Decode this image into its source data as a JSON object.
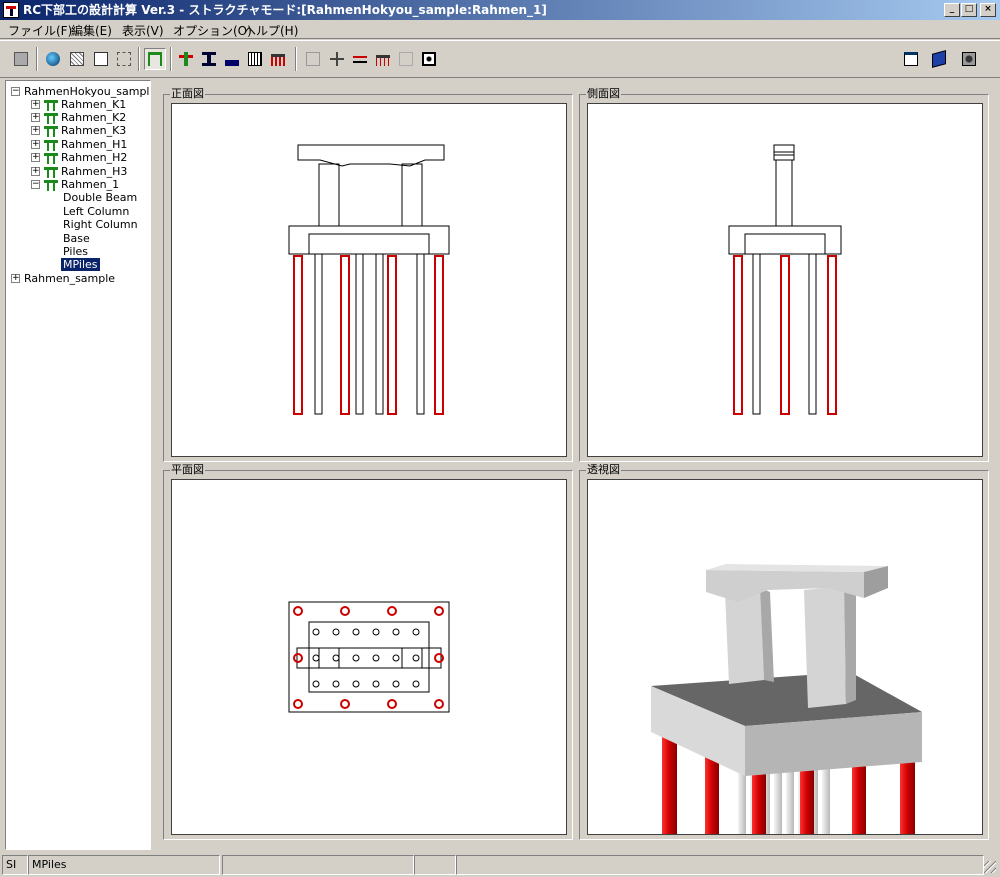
{
  "window": {
    "title": "RC下部工の設計計算 Ver.3 - ストラクチャモード:[RahmenHokyou_sample:Rahmen_1]",
    "minimize": "_",
    "maximize": "□",
    "close": "×"
  },
  "menu": [
    "ファイル(F)",
    "編集(E)",
    "表示(V)",
    "オプション(O)",
    "ヘルプ(H)"
  ],
  "toolbar": {
    "left_icons": [
      "save-icon",
      "globe-icon",
      "image-icon",
      "page-icon",
      "dashed-page-icon",
      "rahmen-structure-icon",
      "pier-icon",
      "column-icon",
      "base-icon",
      "grid-icon",
      "piles-icon",
      "disabled-box-icon",
      "disabled-beam-icon",
      "disabled-bridge-icon",
      "disabled-pile-icon",
      "disabled-load-icon",
      "frame-icon"
    ],
    "right_icons": [
      "window-icon",
      "book-icon",
      "camera-icon"
    ]
  },
  "tree": {
    "root": "RahmenHokyou_sample",
    "children": [
      "Rahmen_K1",
      "Rahmen_K2",
      "Rahmen_K3",
      "Rahmen_H1",
      "Rahmen_H2",
      "Rahmen_H3",
      "Rahmen_1"
    ],
    "expanded_items": [
      "Double Beam",
      "Left Column",
      "Right Column",
      "Base",
      "Piles",
      "MPiles"
    ],
    "selected": "MPiles",
    "root2": "Rahmen_sample"
  },
  "views": {
    "front": "正面図",
    "side": "側面図",
    "plan": "平面図",
    "perspective": "透視図"
  },
  "status": {
    "unit": "SI",
    "selection": "MPiles"
  },
  "colors": {
    "highlight": "#cc0000",
    "title_start": "#0a246a",
    "title_end": "#a6caf0"
  }
}
